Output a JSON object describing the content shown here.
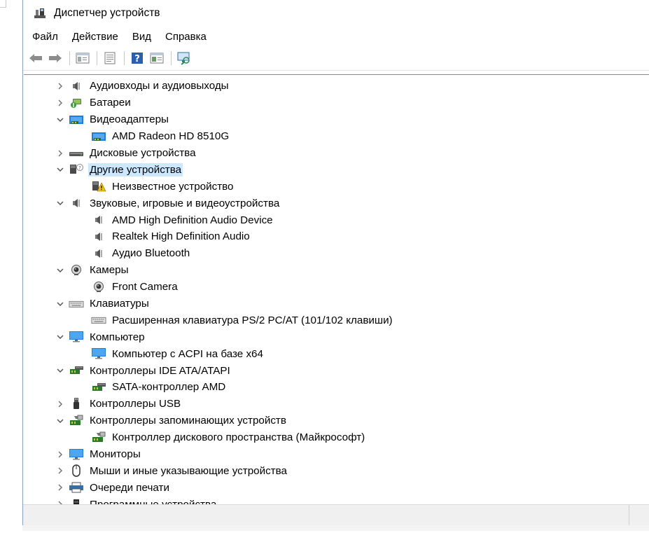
{
  "window": {
    "title": "Диспетчер устройств"
  },
  "menu": [
    "Файл",
    "Действие",
    "Вид",
    "Справка"
  ],
  "toolbar": {
    "buttons": [
      "back-icon",
      "forward-icon",
      "show-hide-tree-icon",
      "properties-icon",
      "help-icon",
      "view-icon",
      "scan-hardware-icon"
    ]
  },
  "tree": [
    {
      "label": "Аудиовходы и аудиовыходы",
      "level": 0,
      "expanded": false,
      "icon": "audio-icon"
    },
    {
      "label": "Батареи",
      "level": 0,
      "expanded": false,
      "icon": "battery-icon"
    },
    {
      "label": "Видеоадаптеры",
      "level": 0,
      "expanded": true,
      "icon": "display-adapter-icon"
    },
    {
      "label": "AMD Radeon HD 8510G",
      "level": 1,
      "icon": "display-adapter-icon"
    },
    {
      "label": "Дисковые устройства",
      "level": 0,
      "expanded": false,
      "icon": "disk-icon"
    },
    {
      "label": "Другие устройства",
      "level": 0,
      "expanded": true,
      "icon": "other-devices-icon",
      "selected": true
    },
    {
      "label": "Неизвестное устройство",
      "level": 1,
      "icon": "warning-device-icon"
    },
    {
      "label": "Звуковые, игровые и видеоустройства",
      "level": 0,
      "expanded": true,
      "icon": "audio-icon"
    },
    {
      "label": "AMD High Definition Audio Device",
      "level": 1,
      "icon": "audio-icon"
    },
    {
      "label": "Realtek High Definition Audio",
      "level": 1,
      "icon": "audio-icon"
    },
    {
      "label": "Аудио Bluetooth",
      "level": 1,
      "icon": "audio-icon"
    },
    {
      "label": "Камеры",
      "level": 0,
      "expanded": true,
      "icon": "camera-icon"
    },
    {
      "label": "Front Camera",
      "level": 1,
      "icon": "camera-icon"
    },
    {
      "label": "Клавиатуры",
      "level": 0,
      "expanded": true,
      "icon": "keyboard-icon"
    },
    {
      "label": "Расширенная клавиатура PS/2 PC/AT (101/102 клавиши)",
      "level": 1,
      "icon": "keyboard-icon"
    },
    {
      "label": "Компьютер",
      "level": 0,
      "expanded": true,
      "icon": "monitor-icon"
    },
    {
      "label": "Компьютер с ACPI на базе x64",
      "level": 1,
      "icon": "monitor-icon"
    },
    {
      "label": "Контроллеры IDE ATA/ATAPI",
      "level": 0,
      "expanded": true,
      "icon": "ide-controller-icon"
    },
    {
      "label": "SATA-контроллер AMD",
      "level": 1,
      "icon": "ide-controller-icon"
    },
    {
      "label": "Контроллеры USB",
      "level": 0,
      "expanded": false,
      "icon": "usb-icon"
    },
    {
      "label": "Контроллеры запоминающих устройств",
      "level": 0,
      "expanded": true,
      "icon": "storage-controller-icon"
    },
    {
      "label": "Контроллер дискового пространства (Майкрософт)",
      "level": 1,
      "icon": "storage-controller-icon"
    },
    {
      "label": "Мониторы",
      "level": 0,
      "expanded": false,
      "icon": "monitor-icon"
    },
    {
      "label": "Мыши и иные указывающие устройства",
      "level": 0,
      "expanded": false,
      "icon": "mouse-icon"
    },
    {
      "label": "Очереди печати",
      "level": 0,
      "expanded": false,
      "icon": "printer-icon"
    },
    {
      "label": "Программные устройства",
      "level": 0,
      "expanded": false,
      "icon": "software-device-icon"
    }
  ],
  "colors": {
    "selection": "#cce8ff",
    "accent": "#1f7fd6"
  }
}
